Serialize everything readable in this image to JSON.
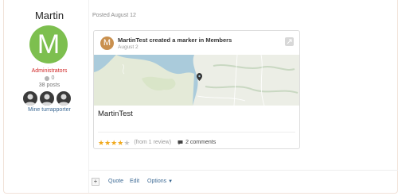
{
  "author": {
    "name": "Martin",
    "avatar_letter": "M",
    "avatar_color": "#7dbf4f",
    "group": "Administrators",
    "reputation": "0",
    "posts": "38 posts",
    "badges": [
      "user-avatar-icon",
      "user-avatar-icon",
      "user-avatar-icon"
    ],
    "profile_link": "Mine turrapporter"
  },
  "post": {
    "date": "Posted August 12"
  },
  "embed": {
    "avatar_letter": "M",
    "avatar_color": "#c9904e",
    "title": "MartinTest created a marker in Members",
    "subtitle": "August 2",
    "marker_title": "MartinTest",
    "rating": 4,
    "rating_max": 5,
    "review_count": "(from 1 review)",
    "comments": "2 comments"
  },
  "actions": {
    "plus": "+",
    "quote": "Quote",
    "edit": "Edit",
    "options": "Options"
  },
  "colors": {
    "link": "#3c6994",
    "group": "#d12828",
    "star": "#f0a81a"
  }
}
